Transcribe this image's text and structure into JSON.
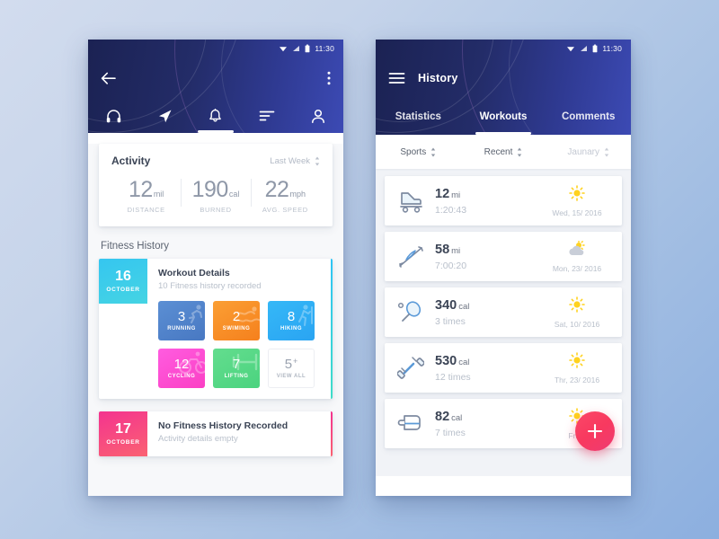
{
  "background": {
    "from": "#d2dcee",
    "to": "#8cafdf"
  },
  "left_phone": {
    "status": {
      "time": "11:30",
      "wifi_icon": "wifi-icon",
      "signal_icon": "signal-icon",
      "battery_icon": "battery-icon"
    },
    "header": {
      "back_icon": "back-arrow-icon",
      "overflow_icon": "more-vertical-icon",
      "gradient_from": "#1b2253",
      "gradient_to": "#3c4ab4"
    },
    "nav": [
      {
        "icon": "headphones-icon",
        "active": false
      },
      {
        "icon": "navigation-arrow-icon",
        "active": false
      },
      {
        "icon": "bell-icon",
        "active": true
      },
      {
        "icon": "sort-lines-icon",
        "active": false
      },
      {
        "icon": "person-icon",
        "active": false
      }
    ],
    "activity": {
      "title": "Activity",
      "range_label": "Last Week",
      "range_icon": "sort-updown-icon",
      "stats": [
        {
          "num": "12",
          "unit": "mil",
          "label": "DISTANCE"
        },
        {
          "num": "190",
          "unit": "cal",
          "label": "BURNED"
        },
        {
          "num": "22",
          "unit": "mph",
          "label": "AVG. SPEED"
        }
      ]
    },
    "fitness_history": {
      "section_title": "Fitness History",
      "cards": [
        {
          "day": "16",
          "month": "OCTOBER",
          "badge_color": "#35c6f0",
          "title": "Workout Details",
          "subtitle": "10 Fitness history recorded",
          "accent_color": "#2ec4f5",
          "tiles": [
            {
              "num": "3",
              "label": "RUNNING",
              "icon": "runner-icon",
              "color": "#4878c2"
            },
            {
              "num": "2",
              "label": "SWIMING",
              "icon": "swimmer-icon",
              "color": "#f5801d"
            },
            {
              "num": "8",
              "label": "HIKING",
              "icon": "hiker-icon",
              "color": "#2aa4f2"
            },
            {
              "num": "12",
              "label": "CYCLING",
              "icon": "bicycle-icon",
              "color": "#fb3fc4"
            },
            {
              "num": "7",
              "label": "LIFTING",
              "icon": "barbell-icon",
              "color": "#4bd37f"
            },
            {
              "num": "5",
              "label": "VIEW ALL",
              "icon": "plus-icon",
              "color": "#ffffff",
              "suffix": "+"
            }
          ]
        },
        {
          "day": "17",
          "month": "OCTOBER",
          "badge_color": "#f4338f",
          "title": "No Fitness History Recorded",
          "subtitle": "Activity details empty",
          "accent_color": "#f4338f",
          "tiles": []
        }
      ]
    }
  },
  "right_phone": {
    "status": {
      "time": "11:30",
      "wifi_icon": "wifi-icon",
      "signal_icon": "signal-icon",
      "battery_icon": "battery-icon"
    },
    "header": {
      "menu_icon": "hamburger-menu-icon",
      "title": "History"
    },
    "tabs": [
      {
        "label": "Statistics",
        "active": false
      },
      {
        "label": "Workouts",
        "active": true
      },
      {
        "label": "Comments",
        "active": false
      }
    ],
    "filters": [
      {
        "label": "Sports",
        "icon": "sort-updown-icon",
        "muted": false
      },
      {
        "label": "Recent",
        "icon": "sort-updown-icon",
        "muted": false
      },
      {
        "label": "Jaunary",
        "icon": "sort-updown-icon",
        "muted": true
      }
    ],
    "rows": [
      {
        "icon": "roller-skate-icon",
        "num": "12",
        "unit": "mi",
        "sub": "1:20:43",
        "weather": "sunny-icon",
        "date": "Wed, 15/ 2016"
      },
      {
        "icon": "kayak-icon",
        "num": "58",
        "unit": "mi",
        "sub": "7:00:20",
        "weather": "partly-cloudy-icon",
        "date": "Mon, 23/ 2016"
      },
      {
        "icon": "racket-icon",
        "num": "340",
        "unit": "cal",
        "sub": "3 times",
        "weather": "sunny-icon",
        "date": "Sat, 10/ 2016"
      },
      {
        "icon": "dumbbell-icon",
        "num": "530",
        "unit": "cal",
        "sub": "12 times",
        "weather": "sunny-icon",
        "date": "Thr, 23/ 2016"
      },
      {
        "icon": "punch-bag-icon",
        "num": "82",
        "unit": "cal",
        "sub": "7 times",
        "weather": "sunny-icon",
        "date": "Fri, 2"
      }
    ],
    "fab": {
      "label": "+",
      "color": "#f8395f"
    }
  }
}
